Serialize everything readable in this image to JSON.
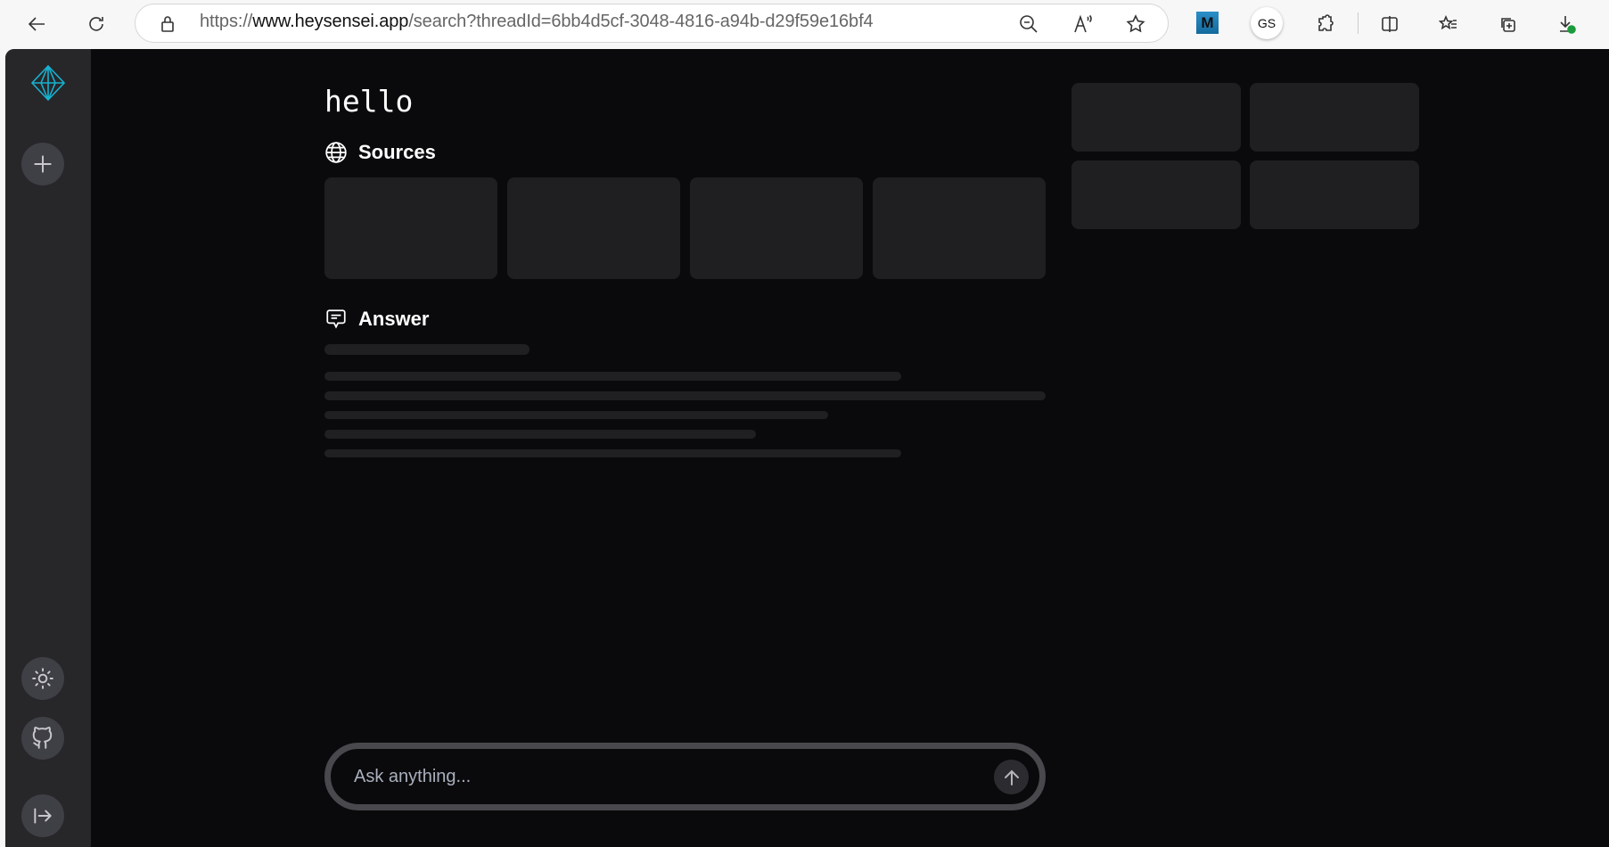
{
  "browser": {
    "url_scheme": "https://",
    "url_host": "www.heysensei.app",
    "url_path": "/search?threadId=6bb4d5cf-3048-4816-a94b-d29f59e16bf4",
    "extension_m_label": "M",
    "profile_label": "GS"
  },
  "sidebar": {
    "logo_color": "#16b8d8",
    "items": [
      "new-thread",
      "theme-toggle",
      "github",
      "collapse-sidebar"
    ]
  },
  "main": {
    "query_title": "hello",
    "sources_label": "Sources",
    "answer_label": "Answer",
    "input_placeholder": "Ask anything..."
  }
}
